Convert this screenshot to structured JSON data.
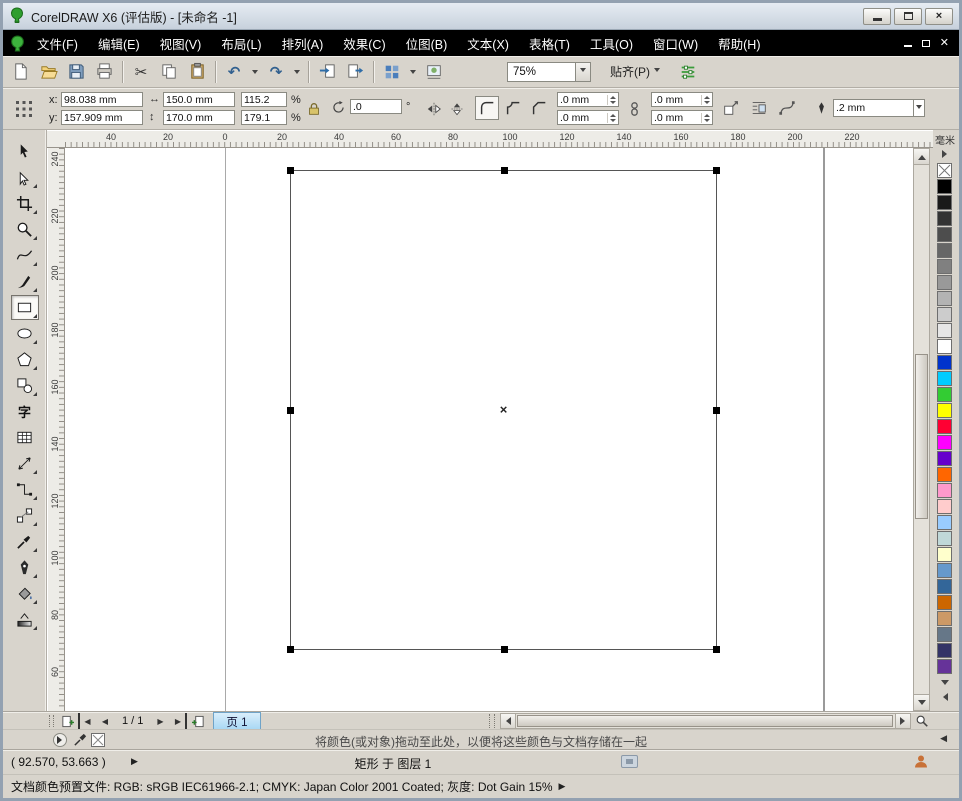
{
  "theme": {
    "titlebar_top": "#e6ecf3",
    "titlebar_bg": "#c7d1dc",
    "chrome_bg": "#d8d4cc",
    "menubar_bg": "#000000",
    "menubar_fg": "#ffffff",
    "canvas_bg": "#ffffff",
    "page_tab_active_bg": "#a6d7f4",
    "logo_green": "#2e9e2e"
  },
  "window": {
    "title": "CorelDRAW X6 (评估版) - [未命名 -1]"
  },
  "menubar": {
    "items": [
      "文件(F)",
      "编辑(E)",
      "视图(V)",
      "布局(L)",
      "排列(A)",
      "效果(C)",
      "位图(B)",
      "文本(X)",
      "表格(T)",
      "工具(O)",
      "窗口(W)",
      "帮助(H)"
    ]
  },
  "toolbar": {
    "zoom_level": "75%",
    "snap_label": "贴齐(P)"
  },
  "property_bar": {
    "x_label": "x:",
    "x_value": "98.038 mm",
    "y_label": "y:",
    "y_value": "157.909 mm",
    "width_value": "150.0 mm",
    "height_value": "170.0 mm",
    "scale_x_value": "115.2",
    "scale_y_value": "179.1",
    "percent_sign": "%",
    "rotation_value": ".0",
    "degree_sign": "°",
    "corner_radius_values": [
      ".0 mm",
      ".0 mm",
      ".0 mm",
      ".0 mm"
    ],
    "outline_width_value": ".2 mm"
  },
  "rulers": {
    "unit_label": "毫米",
    "horizontal_ticks": [
      "40",
      "20",
      "0",
      "20",
      "40",
      "60",
      "80",
      "100",
      "120",
      "140",
      "160",
      "180",
      "200",
      "220"
    ],
    "vertical_ticks": [
      "240",
      "220",
      "200",
      "180",
      "160",
      "140",
      "120",
      "100",
      "80",
      "60"
    ]
  },
  "toolbox": {
    "tools": [
      "pick-tool",
      "shape-tool",
      "crop-tool",
      "zoom-tool",
      "freehand-tool",
      "artistic-media-tool",
      "rectangle-tool",
      "ellipse-tool",
      "polygon-tool",
      "basic-shapes-tool",
      "text-tool",
      "table-tool",
      "dimension-tool",
      "connector-tool",
      "blend-tool",
      "eyedropper-tool",
      "outline-pen-tool",
      "fill-tool",
      "interactive-fill-tool"
    ],
    "selected_tool": "rectangle-tool",
    "text_tool_glyph": "字"
  },
  "color_palette": {
    "colors": [
      "none",
      "#000000",
      "#1a1a1a",
      "#333333",
      "#4d4d4d",
      "#666666",
      "#808080",
      "#999999",
      "#b3b3b3",
      "#cccccc",
      "#e6e6e6",
      "#ffffff",
      "#0033cc",
      "#00ccff",
      "#33cc33",
      "#ffff00",
      "#ff0033",
      "#ff00ff",
      "#6600cc",
      "#ff6600",
      "#ff99cc",
      "#ffcccc",
      "#99ccff",
      "#c0d8d8",
      "#ffffcc",
      "#6699cc",
      "#336699",
      "#cc6600",
      "#cc9966",
      "#667788",
      "#333366",
      "#663399"
    ]
  },
  "navigator": {
    "page_indicator": "1 / 1",
    "page_tab_label": "页 1"
  },
  "document_palette": {
    "hint_text": "将颜色(或对象)拖动至此处，以便将这些颜色与文档存储在一起"
  },
  "status_bar": {
    "cursor_position": "( 92.570, 53.663 )",
    "selection_info": "矩形 于 图层 1"
  },
  "color_profile_bar": {
    "text": "文档颜色预置文件: RGB: sRGB IEC61966-2.1; CMYK: Japan Color 2001 Coated; 灰度: Dot Gain 15%"
  }
}
